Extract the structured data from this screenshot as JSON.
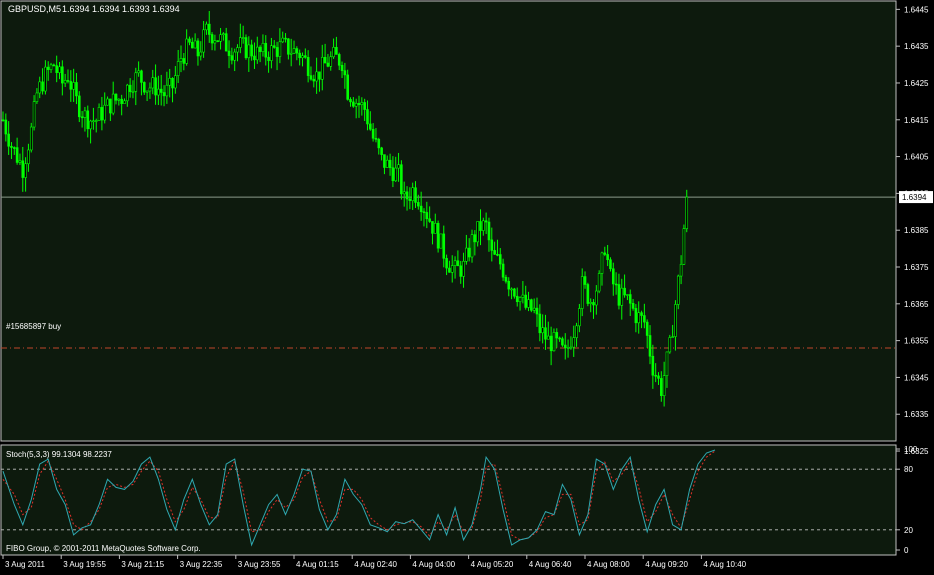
{
  "header": {
    "symbol_label": "GBPUSD,M5",
    "ohlc_text": "1.6394 1.6394 1.6393 1.6394"
  },
  "colors": {
    "background": "#000000",
    "plot_bg": "#0d1a0d",
    "frame": "#c0c0c0",
    "candle": "#00ff00",
    "bid_line": "#8a9a8a",
    "order_line": "#c0452c",
    "stoch_main": "#2fa8b0",
    "stoch_signal": "#e0302a",
    "text": "#ffffff"
  },
  "chart_data": [
    {
      "type": "candlestick",
      "title": "GBPUSD,M5",
      "timeframe": "M5",
      "ylim": [
        1.6328,
        1.6447
      ],
      "y_ticks": [
        "1.6445",
        "1.6435",
        "1.6425",
        "1.6415",
        "1.6405",
        "1.6395",
        "1.6385",
        "1.6375",
        "1.6365",
        "1.6355",
        "1.6345",
        "1.6335",
        "1.6325"
      ],
      "current_price": "1.6394",
      "order_line": {
        "label": "#15685897 buy",
        "price": 1.6353
      },
      "close_path": [
        [
          0,
          1.6415
        ],
        [
          3,
          1.6408
        ],
        [
          7,
          1.6402
        ],
        [
          10,
          1.6412
        ],
        [
          12,
          1.6422
        ],
        [
          15,
          1.6427
        ],
        [
          18,
          1.643
        ],
        [
          21,
          1.6425
        ],
        [
          23,
          1.6427
        ],
        [
          26,
          1.642
        ],
        [
          29,
          1.6416
        ],
        [
          31,
          1.6415
        ],
        [
          33,
          1.6415
        ],
        [
          36,
          1.6418
        ],
        [
          39,
          1.642
        ],
        [
          42,
          1.6421
        ],
        [
          45,
          1.6425
        ],
        [
          48,
          1.6427
        ],
        [
          51,
          1.6424
        ],
        [
          54,
          1.6424
        ],
        [
          57,
          1.6422
        ],
        [
          60,
          1.6424
        ],
        [
          63,
          1.6432
        ],
        [
          66,
          1.6435
        ],
        [
          69,
          1.6433
        ],
        [
          72,
          1.6439
        ],
        [
          75,
          1.6438
        ],
        [
          78,
          1.6436
        ],
        [
          81,
          1.6434
        ],
        [
          84,
          1.6435
        ],
        [
          87,
          1.6434
        ],
        [
          90,
          1.6433
        ],
        [
          93,
          1.6433
        ],
        [
          96,
          1.6434
        ],
        [
          99,
          1.6435
        ],
        [
          102,
          1.6434
        ],
        [
          105,
          1.6433
        ],
        [
          108,
          1.643
        ],
        [
          111,
          1.6427
        ],
        [
          114,
          1.643
        ],
        [
          117,
          1.6432
        ],
        [
          120,
          1.6431
        ],
        [
          122,
          1.6423
        ],
        [
          125,
          1.642
        ],
        [
          128,
          1.6418
        ],
        [
          131,
          1.641
        ],
        [
          134,
          1.6404
        ],
        [
          137,
          1.6402
        ],
        [
          140,
          1.64
        ],
        [
          142,
          1.6393
        ],
        [
          145,
          1.6396
        ],
        [
          148,
          1.6393
        ],
        [
          151,
          1.6388
        ],
        [
          154,
          1.6383
        ],
        [
          157,
          1.6377
        ],
        [
          160,
          1.6374
        ],
        [
          163,
          1.6375
        ],
        [
          166,
          1.6382
        ],
        [
          169,
          1.6386
        ],
        [
          171,
          1.6386
        ],
        [
          173,
          1.6378
        ],
        [
          176,
          1.6376
        ],
        [
          179,
          1.6371
        ],
        [
          182,
          1.6368
        ],
        [
          185,
          1.6364
        ],
        [
          188,
          1.6363
        ],
        [
          190,
          1.6358
        ],
        [
          193,
          1.6355
        ],
        [
          196,
          1.6354
        ],
        [
          199,
          1.6351
        ],
        [
          202,
          1.6358
        ],
        [
          205,
          1.637
        ],
        [
          208,
          1.6366
        ],
        [
          211,
          1.6371
        ],
        [
          213,
          1.6381
        ],
        [
          215,
          1.6372
        ],
        [
          218,
          1.6367
        ],
        [
          221,
          1.6366
        ],
        [
          224,
          1.6362
        ],
        [
          227,
          1.636
        ],
        [
          230,
          1.6348
        ],
        [
          233,
          1.6342
        ],
        [
          236,
          1.6353
        ],
        [
          238,
          1.6365
        ],
        [
          240,
          1.6377
        ],
        [
          242,
          1.6394
        ]
      ],
      "x_ticks": [
        "3 Aug 2011",
        "3 Aug 19:55",
        "3 Aug 21:15",
        "3 Aug 22:35",
        "3 Aug 23:55",
        "4 Aug 01:15",
        "4 Aug 02:40",
        "4 Aug 04:00",
        "4 Aug 05:20",
        "4 Aug 06:40",
        "4 Aug 08:00",
        "4 Aug 09:20",
        "4 Aug 10:40"
      ],
      "grid": false
    },
    {
      "type": "line",
      "title": "Stoch(5,3,3) 99.1304 98.2237",
      "ylim": [
        0,
        100
      ],
      "y_ticks": [
        "100",
        "80",
        "20",
        "0"
      ],
      "levels": [
        80,
        20
      ],
      "series": [
        {
          "role": "main",
          "points": [
            [
              0,
              78
            ],
            [
              4,
              45
            ],
            [
              7,
              25
            ],
            [
              10,
              50
            ],
            [
              13,
              85
            ],
            [
              16,
              90
            ],
            [
              19,
              60
            ],
            [
              22,
              45
            ],
            [
              25,
              15
            ],
            [
              28,
              22
            ],
            [
              31,
              25
            ],
            [
              34,
              45
            ],
            [
              37,
              70
            ],
            [
              40,
              62
            ],
            [
              43,
              60
            ],
            [
              46,
              68
            ],
            [
              49,
              85
            ],
            [
              52,
              92
            ],
            [
              55,
              70
            ],
            [
              58,
              40
            ],
            [
              61,
              20
            ],
            [
              64,
              50
            ],
            [
              67,
              70
            ],
            [
              70,
              45
            ],
            [
              73,
              25
            ],
            [
              76,
              35
            ],
            [
              79,
              85
            ],
            [
              82,
              90
            ],
            [
              85,
              45
            ],
            [
              88,
              5
            ],
            [
              91,
              25
            ],
            [
              94,
              45
            ],
            [
              97,
              55
            ],
            [
              100,
              35
            ],
            [
              103,
              55
            ],
            [
              106,
              80
            ],
            [
              109,
              78
            ],
            [
              112,
              40
            ],
            [
              115,
              20
            ],
            [
              118,
              35
            ],
            [
              121,
              70
            ],
            [
              124,
              55
            ],
            [
              127,
              45
            ],
            [
              130,
              25
            ],
            [
              133,
              22
            ],
            [
              136,
              18
            ],
            [
              139,
              28
            ],
            [
              142,
              26
            ],
            [
              145,
              30
            ],
            [
              148,
              20
            ],
            [
              151,
              10
            ],
            [
              154,
              35
            ],
            [
              157,
              15
            ],
            [
              160,
              42
            ],
            [
              163,
              10
            ],
            [
              166,
              25
            ],
            [
              169,
              60
            ],
            [
              171,
              92
            ],
            [
              174,
              80
            ],
            [
              177,
              40
            ],
            [
              180,
              5
            ],
            [
              183,
              10
            ],
            [
              186,
              12
            ],
            [
              189,
              20
            ],
            [
              192,
              38
            ],
            [
              195,
              35
            ],
            [
              198,
              65
            ],
            [
              201,
              50
            ],
            [
              204,
              15
            ],
            [
              207,
              35
            ],
            [
              210,
              90
            ],
            [
              213,
              85
            ],
            [
              216,
              60
            ],
            [
              219,
              80
            ],
            [
              222,
              92
            ],
            [
              225,
              50
            ],
            [
              228,
              18
            ],
            [
              231,
              45
            ],
            [
              234,
              60
            ],
            [
              237,
              25
            ],
            [
              240,
              20
            ],
            [
              243,
              60
            ],
            [
              246,
              85
            ],
            [
              249,
              96
            ],
            [
              252,
              99
            ]
          ]
        },
        {
          "role": "signal",
          "points": [
            [
              0,
              70
            ],
            [
              4,
              55
            ],
            [
              7,
              35
            ],
            [
              10,
              42
            ],
            [
              13,
              75
            ],
            [
              16,
              88
            ],
            [
              19,
              70
            ],
            [
              22,
              50
            ],
            [
              25,
              25
            ],
            [
              28,
              20
            ],
            [
              31,
              28
            ],
            [
              34,
              40
            ],
            [
              37,
              62
            ],
            [
              40,
              65
            ],
            [
              43,
              62
            ],
            [
              46,
              65
            ],
            [
              49,
              78
            ],
            [
              52,
              88
            ],
            [
              55,
              78
            ],
            [
              58,
              50
            ],
            [
              61,
              28
            ],
            [
              64,
              40
            ],
            [
              67,
              62
            ],
            [
              70,
              50
            ],
            [
              73,
              32
            ],
            [
              76,
              32
            ],
            [
              79,
              72
            ],
            [
              82,
              88
            ],
            [
              85,
              58
            ],
            [
              88,
              18
            ],
            [
              91,
              20
            ],
            [
              94,
              38
            ],
            [
              97,
              50
            ],
            [
              100,
              42
            ],
            [
              103,
              50
            ],
            [
              106,
              72
            ],
            [
              109,
              78
            ],
            [
              112,
              50
            ],
            [
              115,
              28
            ],
            [
              118,
              30
            ],
            [
              121,
              60
            ],
            [
              124,
              60
            ],
            [
              127,
              50
            ],
            [
              130,
              32
            ],
            [
              133,
              25
            ],
            [
              136,
              20
            ],
            [
              139,
              25
            ],
            [
              142,
              27
            ],
            [
              145,
              28
            ],
            [
              148,
              23
            ],
            [
              151,
              14
            ],
            [
              154,
              28
            ],
            [
              157,
              20
            ],
            [
              160,
              35
            ],
            [
              163,
              18
            ],
            [
              166,
              22
            ],
            [
              169,
              50
            ],
            [
              171,
              82
            ],
            [
              174,
              85
            ],
            [
              177,
              52
            ],
            [
              180,
              15
            ],
            [
              183,
              10
            ],
            [
              186,
              12
            ],
            [
              189,
              18
            ],
            [
              192,
              32
            ],
            [
              195,
              35
            ],
            [
              198,
              55
            ],
            [
              201,
              55
            ],
            [
              204,
              25
            ],
            [
              207,
              30
            ],
            [
              210,
              78
            ],
            [
              213,
              87
            ],
            [
              216,
              68
            ],
            [
              219,
              75
            ],
            [
              222,
              88
            ],
            [
              225,
              62
            ],
            [
              228,
              28
            ],
            [
              231,
              38
            ],
            [
              234,
              55
            ],
            [
              237,
              35
            ],
            [
              240,
              22
            ],
            [
              243,
              50
            ],
            [
              246,
              78
            ],
            [
              249,
              92
            ],
            [
              252,
              98
            ]
          ]
        }
      ]
    }
  ],
  "footer": {
    "copyright": "FIBO Group, © 2001-2011 MetaQuotes Software Corp."
  }
}
